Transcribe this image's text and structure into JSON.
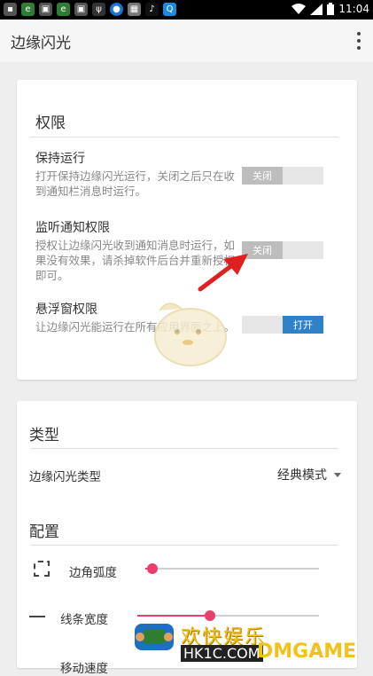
{
  "status_bar": {
    "time": "11:04",
    "notification_icons": [
      "sim-icon",
      "e-icon",
      "gallery-icon",
      "e-icon",
      "gallery-icon",
      "usb-icon",
      "messenger-icon",
      "photo-icon",
      "tiktok-icon",
      "qq-icon"
    ],
    "system_icons": [
      "wifi-icon",
      "signal-icon",
      "battery-icon"
    ]
  },
  "app_bar": {
    "title": "边缘闪光",
    "menu_icon": "overflow-menu-icon"
  },
  "permissions": {
    "title": "权限",
    "items": [
      {
        "title": "保持运行",
        "desc": "打开保持边缘闪光运行，关闭之后只在收到通知栏消息时运行。",
        "toggle_label": "关闭",
        "on": false
      },
      {
        "title": "监听通知权限",
        "desc": "授权让边缘闪光收到通知消息时运行，如果没有效果，请杀掉软件后台并重新授权即可。",
        "toggle_label": "关闭",
        "on": false
      },
      {
        "title": "悬浮窗权限",
        "desc": "让边缘闪光能运行在所有应用界面之上。",
        "toggle_label": "打开",
        "on": true
      }
    ]
  },
  "type_section": {
    "title": "类型",
    "row_label": "边缘闪光类型",
    "selected": "经典模式"
  },
  "config_section": {
    "title": "配置",
    "rows": [
      {
        "label": "边角弧度",
        "icon": "corner-radius-icon",
        "value": 0.04
      },
      {
        "label": "线条宽度",
        "icon": "line-width-icon",
        "value": 0.4
      },
      {
        "label": "移动速度",
        "icon": "speed-icon"
      }
    ]
  },
  "watermark": {
    "text_top": "欢快娱乐",
    "text_bottom": "HK1C.COM",
    "text_brand": "DMGAME"
  },
  "colors": {
    "accent": "#e83e6b",
    "toggle_on": "#2e82c7",
    "arrow": "#e02020"
  }
}
